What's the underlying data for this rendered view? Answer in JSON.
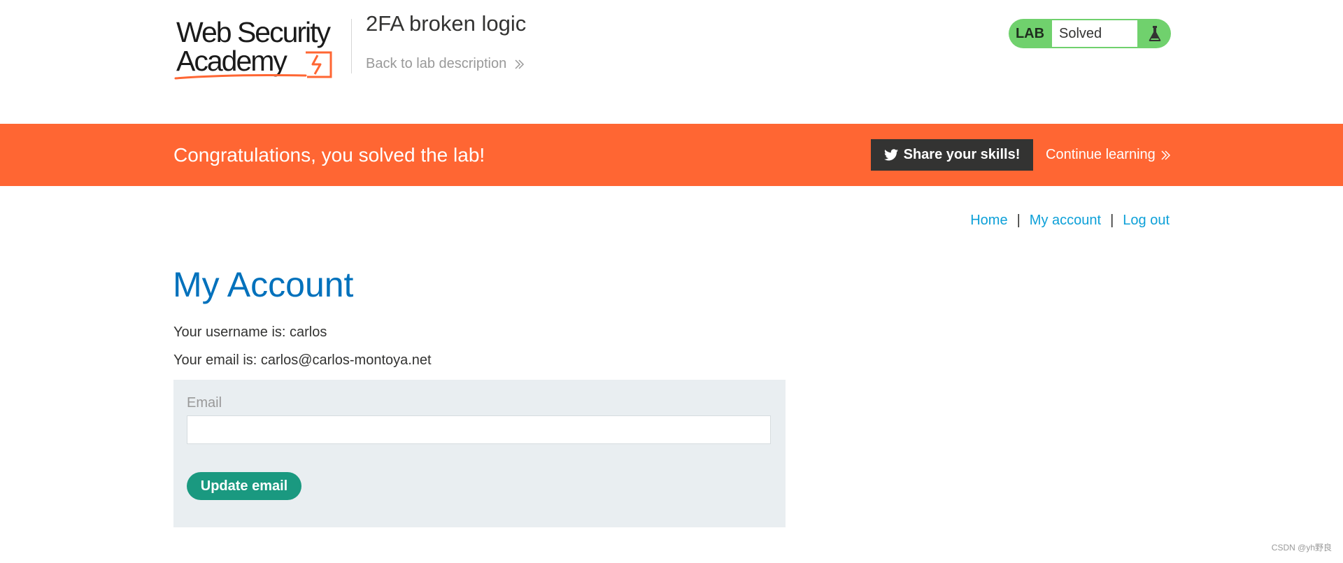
{
  "header": {
    "logo": {
      "line1": "Web Security",
      "line2": "Academy"
    },
    "lab_title": "2FA broken logic",
    "back_link_label": "Back to lab description",
    "lab_status": {
      "label": "LAB",
      "value": "Solved",
      "icon": "flask-icon"
    }
  },
  "banner": {
    "message": "Congratulations, you solved the lab!",
    "share_label": "Share your skills!",
    "share_icon": "twitter-icon",
    "continue_label": "Continue learning"
  },
  "nav": {
    "home": "Home",
    "separator": "|",
    "my_account": "My account",
    "log_out": "Log out"
  },
  "main": {
    "heading": "My Account",
    "username_line": "Your username is: carlos",
    "email_line": "Your email is: carlos@carlos-montoya.net",
    "form": {
      "email_label": "Email",
      "email_value": "",
      "email_placeholder": "",
      "submit_label": "Update email"
    }
  },
  "watermark": "CSDN @yh野良",
  "colors": {
    "brand_orange": "#ff6633",
    "lab_green": "#70d16d",
    "heading_blue": "#0071bc",
    "link_blue": "#0da0d8",
    "button_teal": "#1a9980",
    "form_bg": "#e9eef1",
    "dark": "#333332"
  }
}
